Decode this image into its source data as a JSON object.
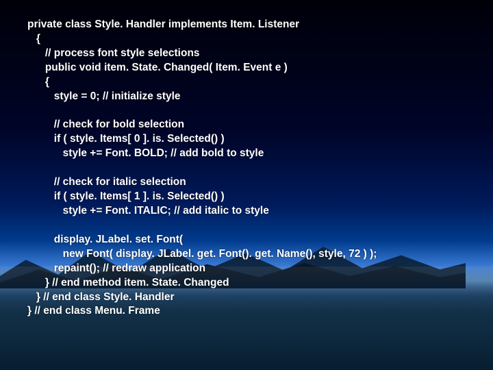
{
  "code": {
    "line01": "private class Style. Handler implements Item. Listener",
    "line02": "   {",
    "line03": "      // process font style selections",
    "line04": "      public void item. State. Changed( Item. Event e )",
    "line05": "      {",
    "line06": "         style = 0; // initialize style",
    "line07": "",
    "line08": "         // check for bold selection",
    "line09": "         if ( style. Items[ 0 ]. is. Selected() )",
    "line10": "            style += Font. BOLD; // add bold to style",
    "line11": "",
    "line12": "         // check for italic selection",
    "line13": "         if ( style. Items[ 1 ]. is. Selected() )",
    "line14": "            style += Font. ITALIC; // add italic to style",
    "line15": "",
    "line16": "         display. JLabel. set. Font(",
    "line17": "            new Font( display. JLabel. get. Font(). get. Name(), style, 72 ) );",
    "line18": "         repaint(); // redraw application",
    "line19": "      } // end method item. State. Changed",
    "line20": "   } // end class Style. Handler",
    "line21": "} // end class Menu. Frame"
  }
}
